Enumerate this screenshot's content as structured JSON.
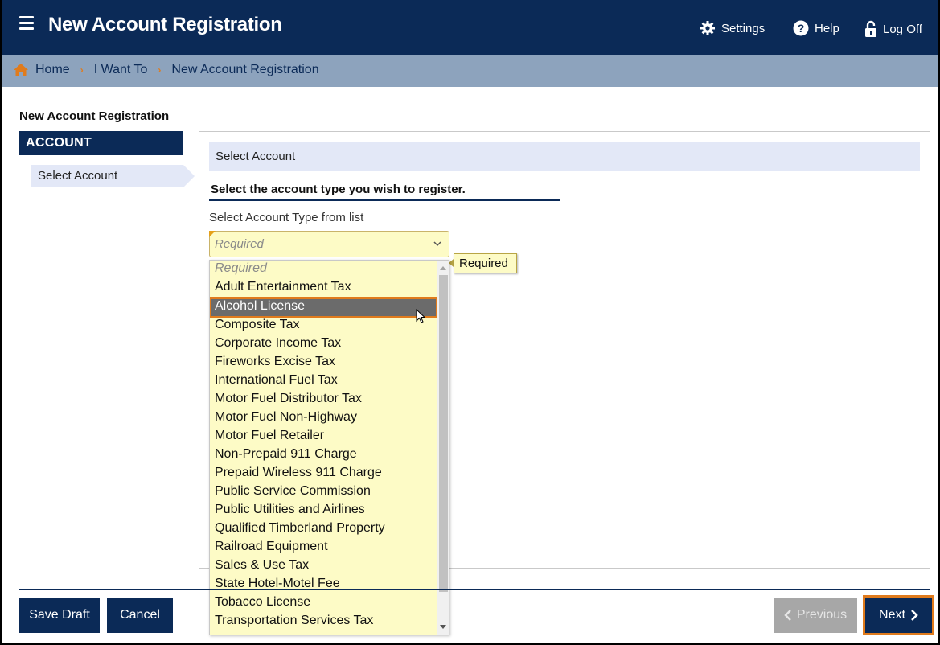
{
  "header": {
    "title": "New Account Registration",
    "settings_label": "Settings",
    "help_label": "Help",
    "logoff_label": "Log Off"
  },
  "breadcrumb": [
    "Home",
    "I Want To",
    "New Account Registration"
  ],
  "page": {
    "title": "New Account Registration"
  },
  "nav": {
    "header": "ACCOUNT",
    "items": [
      {
        "label": "Select Account",
        "active": true
      }
    ]
  },
  "main": {
    "section_title": "Select Account",
    "prompt": "Select the account type you wish to register.",
    "field_label": "Select Account Type from list",
    "select_value": "Required",
    "tooltip": "Required",
    "options": [
      "Required",
      "Adult Entertainment Tax",
      "Alcohol License",
      "Composite Tax",
      "Corporate Income Tax",
      "Fireworks Excise Tax",
      "International Fuel Tax",
      "Motor Fuel Distributor Tax",
      "Motor Fuel Non-Highway",
      "Motor Fuel Retailer",
      "Non-Prepaid 911 Charge",
      "Prepaid Wireless 911 Charge",
      "Public Service Commission",
      "Public Utilities and Airlines",
      "Qualified Timberland Property",
      "Railroad Equipment",
      "Sales & Use Tax",
      "State Hotel-Motel Fee",
      "Tobacco License",
      "Transportation Services Tax"
    ],
    "highlighted_option": "Alcohol License"
  },
  "footer": {
    "save_draft": "Save Draft",
    "cancel": "Cancel",
    "previous": "Previous",
    "next": "Next"
  },
  "colors": {
    "navy": "#0b2a57",
    "breadcrumb_bg": "#8da3bd",
    "accent_orange": "#e07b1c",
    "required_yellow": "#fdfbc6",
    "section_bg": "#e3e8f7"
  }
}
